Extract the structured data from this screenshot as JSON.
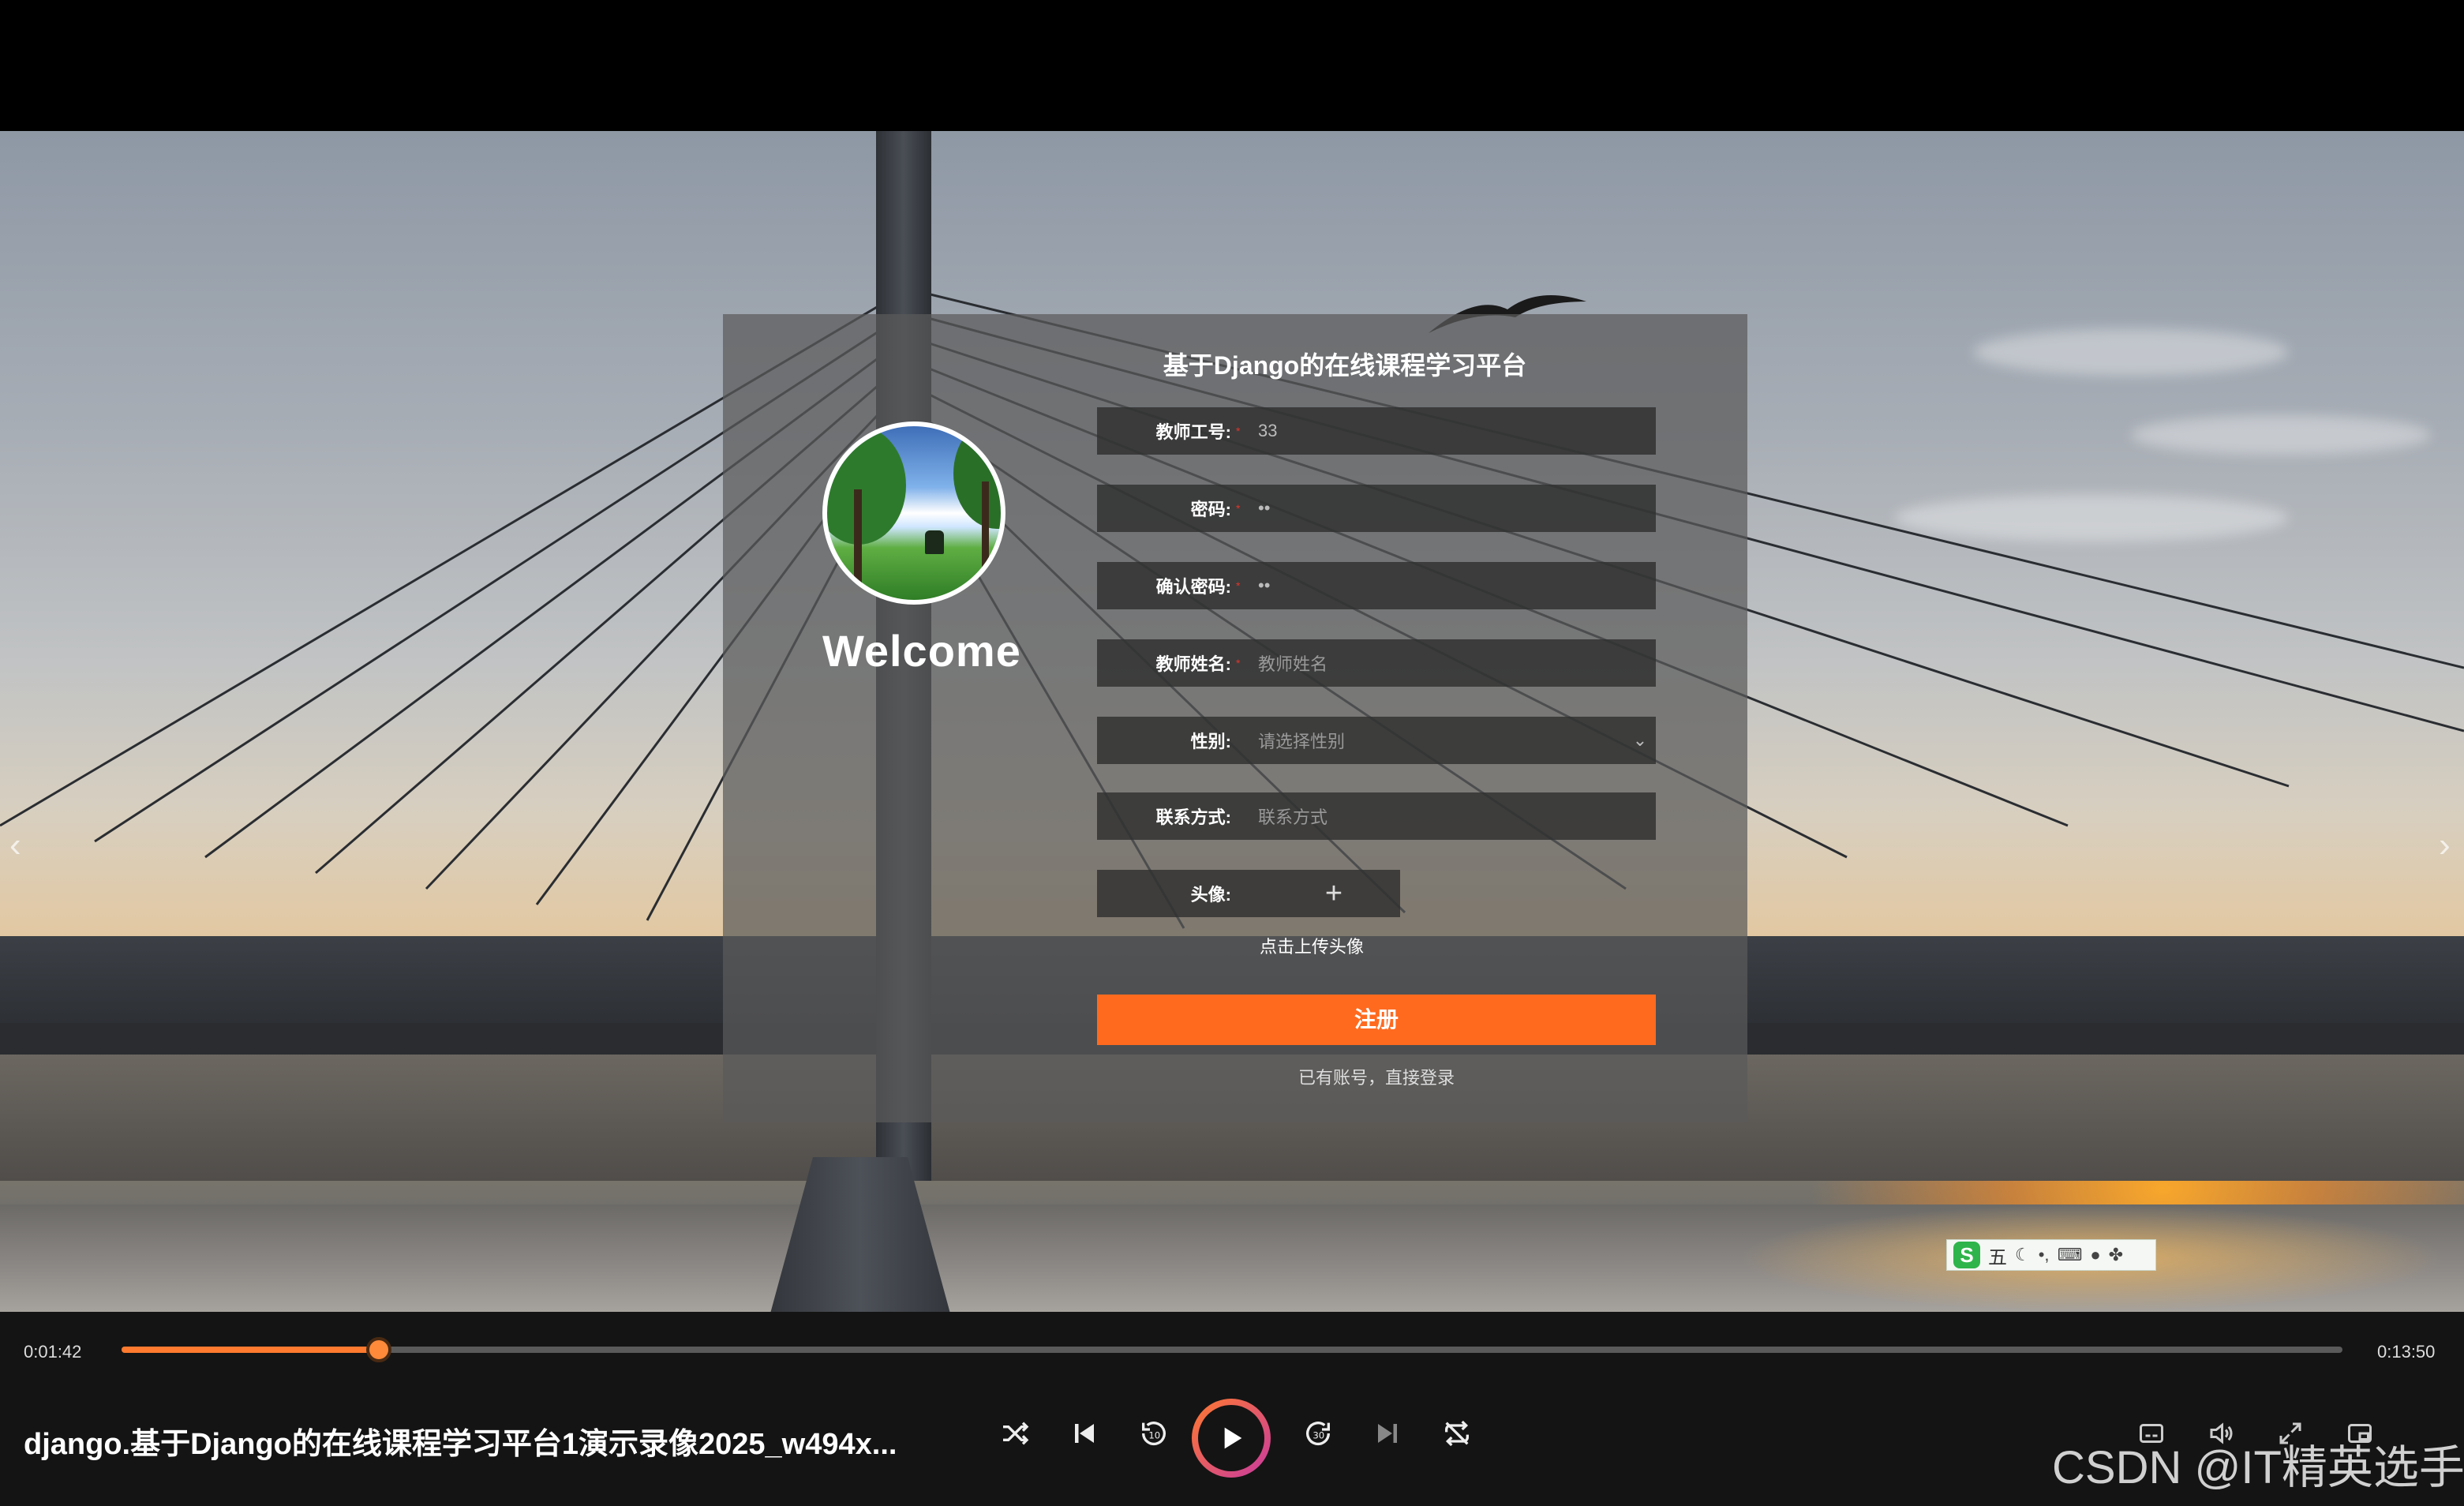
{
  "card": {
    "title": "基于Django的在线课程学习平台",
    "welcome": "Welcome",
    "fields": [
      {
        "label": "教师工号:",
        "value": "33",
        "placeholder": ""
      },
      {
        "label": "密码:",
        "value": "••",
        "placeholder": ""
      },
      {
        "label": "确认密码:",
        "value": "••",
        "placeholder": ""
      },
      {
        "label": "教师姓名:",
        "value": "",
        "placeholder": "教师姓名"
      },
      {
        "label": "性别:",
        "value": "",
        "placeholder": "请选择性别"
      },
      {
        "label": "联系方式:",
        "value": "",
        "placeholder": "联系方式"
      }
    ],
    "avatar_label": "头像:",
    "upload_hint": "点击上传头像",
    "submit_label": "注册",
    "login_link": "已有账号，直接登录"
  },
  "ime": {
    "mode": "五"
  },
  "player": {
    "current_time": "0:01:42",
    "total_time": "0:13:50",
    "progress": 0.116,
    "file_title": "django.基于Django的在线课程学习平台1演示录像2025_w494x...",
    "controls": {
      "shuffle": "shuffle-icon",
      "previous": "previous-icon",
      "rewind": "rewind-10-icon",
      "play": "play-icon",
      "forward": "forward-30-icon",
      "next": "next-icon",
      "repeat": "repeat-off-icon"
    },
    "accent_color": "#ff7a2e"
  },
  "watermark": "CSDN @IT精英选手"
}
